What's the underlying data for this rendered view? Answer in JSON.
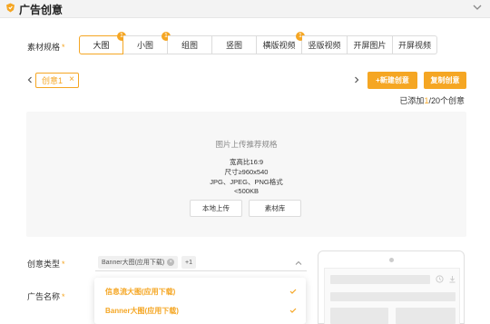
{
  "header": {
    "title": "广告创意"
  },
  "material": {
    "label": "素材规格",
    "required_mark": "*",
    "options": [
      {
        "label": "大图",
        "badge": "1",
        "active": true
      },
      {
        "label": "小图",
        "badge": "1",
        "active": false
      },
      {
        "label": "组图",
        "badge": "",
        "active": false
      },
      {
        "label": "竖图",
        "badge": "",
        "active": false
      },
      {
        "label": "横版视频",
        "badge": "1",
        "active": false
      },
      {
        "label": "竖版视频",
        "badge": "",
        "active": false
      },
      {
        "label": "开屏图片",
        "badge": "",
        "active": false
      },
      {
        "label": "开屏视频",
        "badge": "",
        "active": false
      }
    ]
  },
  "creative_tabs": {
    "chip_label": "创意1",
    "close_glyph": "×"
  },
  "buttons": {
    "new_creative": "+新建创意",
    "copy_creative": "复制创意"
  },
  "counter": {
    "prefix": "已添加",
    "current": "1",
    "sep": "/",
    "total": "20",
    "suffix": "个创意"
  },
  "upload": {
    "title": "图片上传推荐规格",
    "ratio": "宽高比16:9",
    "size": "尺寸≥960x540",
    "formats": "JPG、JPEG、PNG格式",
    "max": "<500KB",
    "local_upload": "本地上传",
    "library": "素材库"
  },
  "creative_type": {
    "label": "创意类型",
    "required_mark": "*",
    "tag": "Banner大图(应用下载)",
    "more": "+1",
    "dropdown": [
      "信息流大图(应用下载)",
      "Banner大图(应用下载)"
    ]
  },
  "ad_name": {
    "label": "广告名称",
    "required_mark": "*"
  },
  "colors": {
    "accent": "#f5a623"
  }
}
